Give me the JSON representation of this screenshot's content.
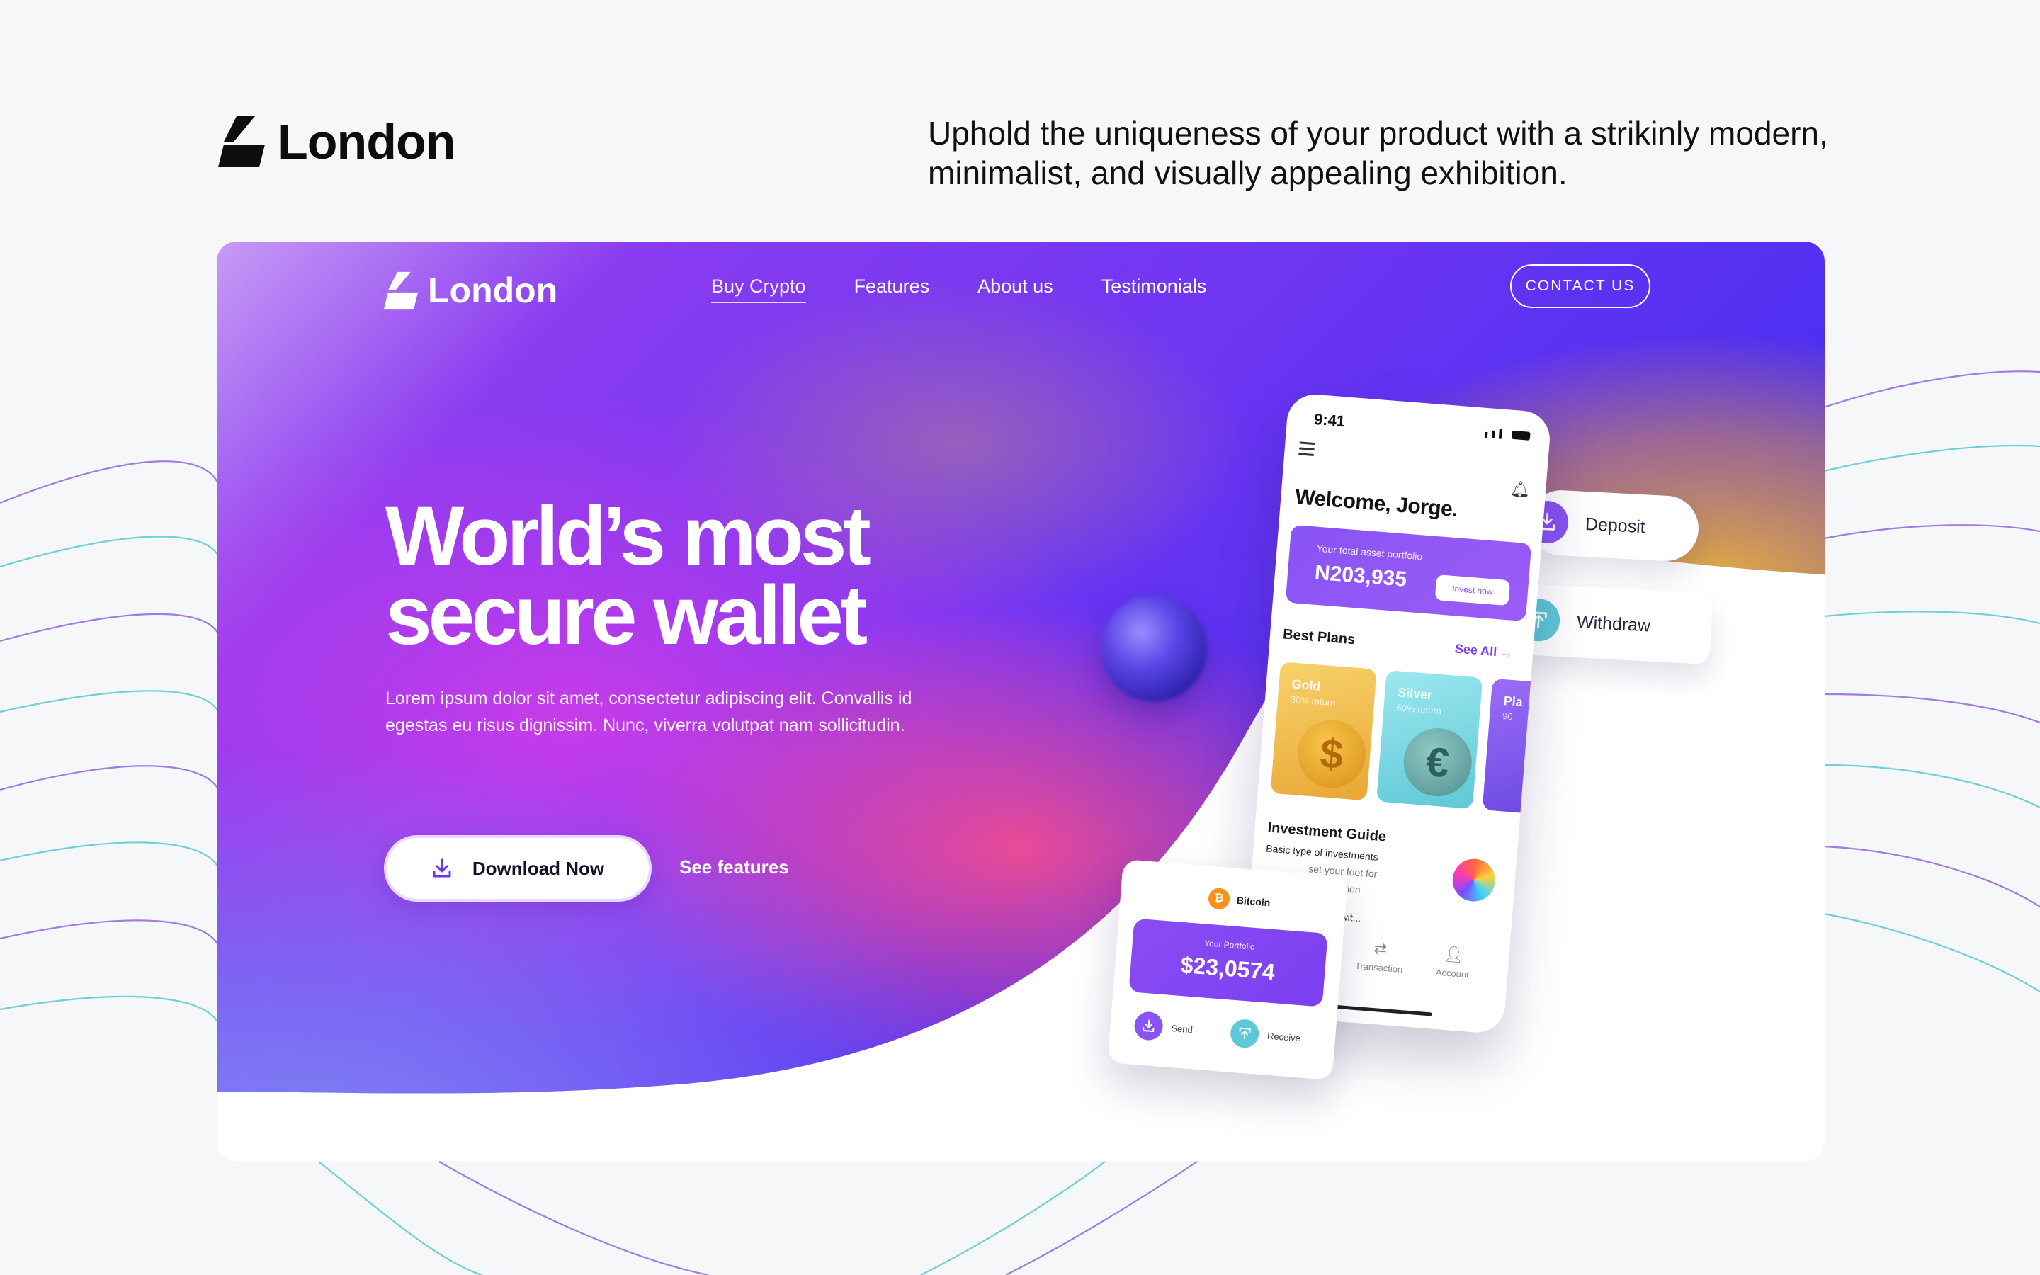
{
  "outer": {
    "brand": "London",
    "tagline": "Uphold the uniqueness of your product with a strikinly modern, minimalist, and visually appealing exhibition."
  },
  "site": {
    "brand": "London",
    "nav": [
      "Buy Crypto",
      "Features",
      "About us",
      "Testimonials"
    ],
    "active_nav": "Buy Crypto",
    "contact_label": "CONTACT US",
    "hero": {
      "title_line1": "World’s most",
      "title_line2": "secure wallet",
      "subtitle": "Lorem ipsum dolor sit amet, consectetur adipiscing elit. Convallis id egestas eu risus dignissim. Nunc, viverra volutpat nam sollicitudin.",
      "download_label": "Download Now",
      "see_features_label": "See features"
    },
    "pills": {
      "deposit": "Deposit",
      "withdraw": "Withdraw"
    },
    "phone": {
      "time": "9:41",
      "welcome": "Welcome, Jorge.",
      "asset_label": "Your total asset portfolio",
      "asset_value": "N203,935",
      "invest_label": "Invest now",
      "best_plans": "Best Plans",
      "see_all": "See All →",
      "plans": [
        {
          "name": "Gold",
          "rate": "30% return",
          "symbol": "$"
        },
        {
          "name": "Silver",
          "rate": "60% return",
          "symbol": "€"
        },
        {
          "name": "Pla",
          "rate": "90",
          "symbol": ""
        }
      ],
      "investment_guide": "Investment Guide",
      "guide_sub": "Basic type of investments",
      "guide_line1": "set your foot for",
      "guide_line2": "of recession",
      "start_text": "ou start wit...",
      "tabs": [
        "Transaction",
        "Account"
      ]
    },
    "portfolio": {
      "coin_name": "Bitcoin",
      "label": "Your Portfolio",
      "value": "$23,0574",
      "send": "Send",
      "receive": "Receive"
    }
  },
  "colors": {
    "purple": "#7b2ff7",
    "violet_accent": "#8a53f5",
    "indigo": "#3a2bf0",
    "gold": "#e9b23a",
    "teal": "#5ec8d6",
    "pink": "#e2428f"
  }
}
